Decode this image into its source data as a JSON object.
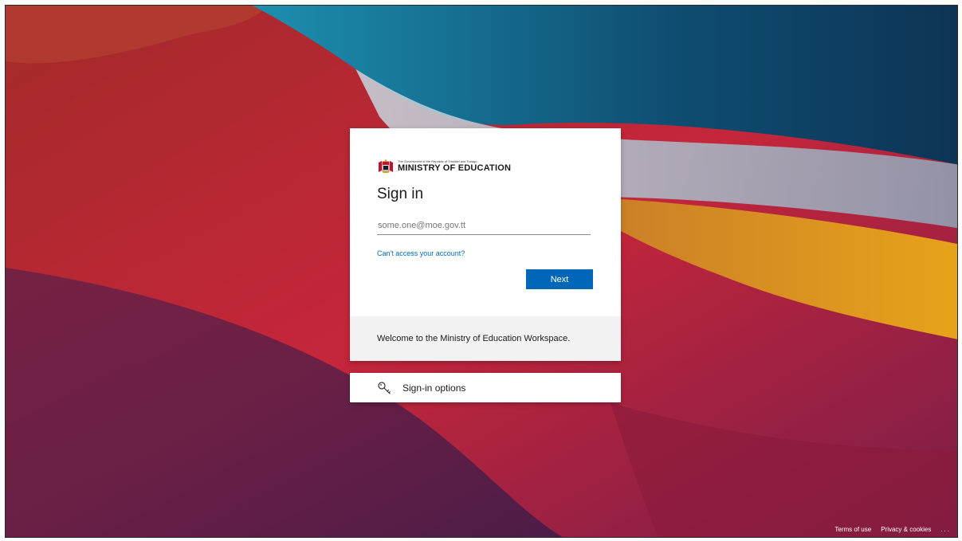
{
  "logo": {
    "small_text": "The Government of the Republic of Trinidad and Tobago",
    "big_text": "MINISTRY OF EDUCATION"
  },
  "signin": {
    "title": "Sign in",
    "email_placeholder": "some.one@moe.gov.tt",
    "email_value": "",
    "cant_access_link": "Can't access your account?",
    "next_button": "Next",
    "welcome_message": "Welcome to the Ministry of Education Workspace."
  },
  "options": {
    "label": "Sign-in options",
    "icon": "key-icon"
  },
  "footer": {
    "terms": "Terms of use",
    "privacy": "Privacy & cookies",
    "more": "..."
  },
  "colors": {
    "accent": "#0067b8",
    "panel": "#f2f2f2"
  }
}
